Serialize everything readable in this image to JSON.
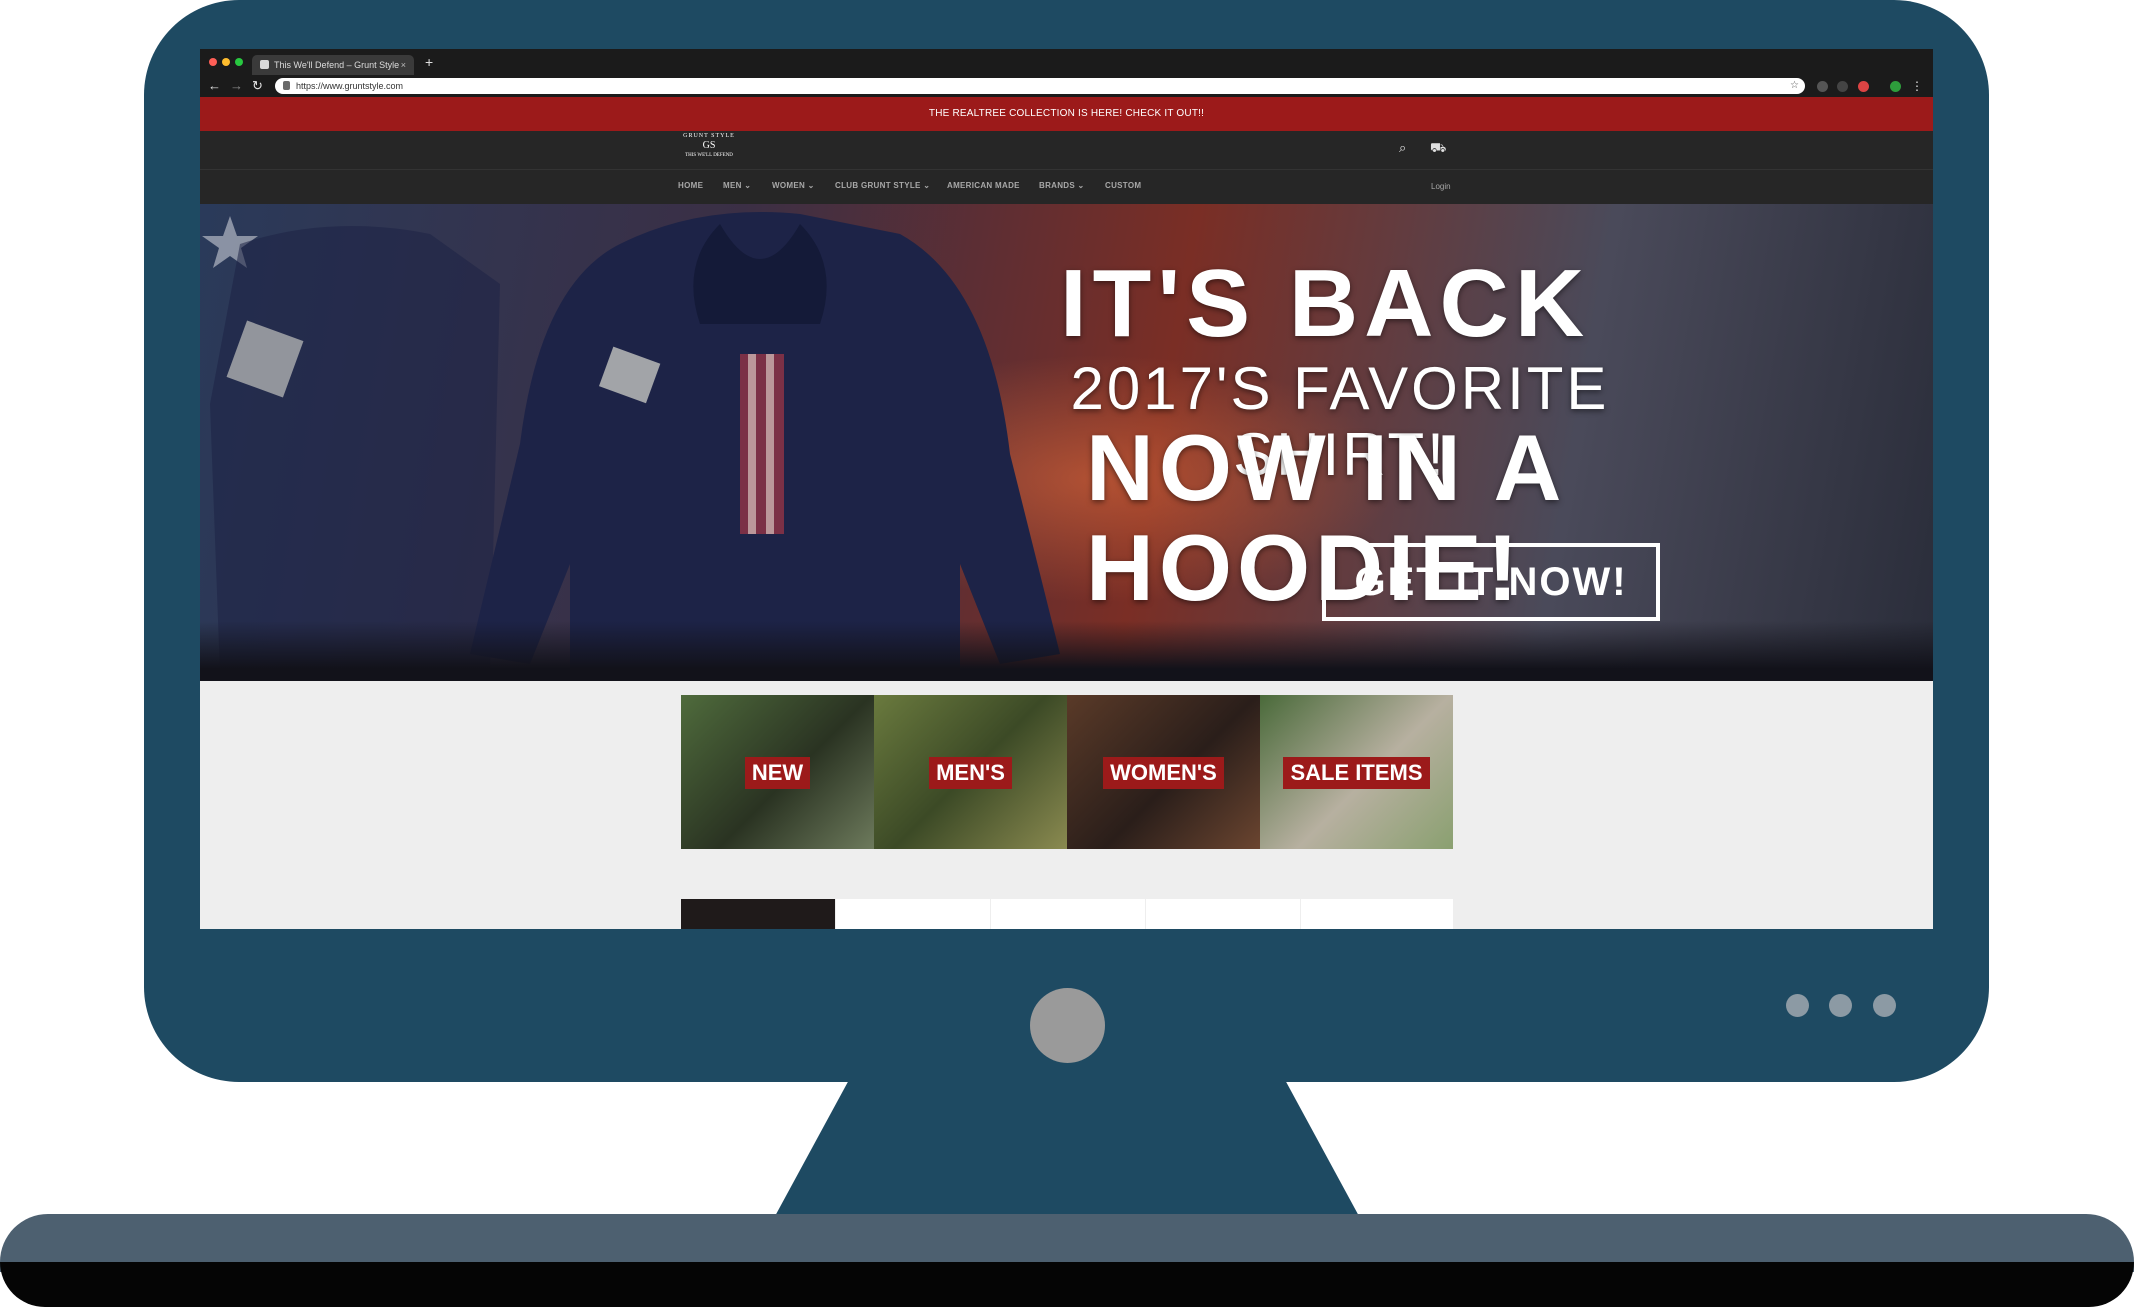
{
  "browser": {
    "tab_title": "This We'll Defend – Grunt Style",
    "tab_close": "×",
    "new_tab": "+",
    "url": "https://www.gruntstyle.com",
    "back_icon": "←",
    "forward_icon": "→",
    "reload_icon": "↻",
    "bookmark_icon": "☆",
    "menu_icon": "⋮"
  },
  "promo_bar": {
    "text": "THE REALTREE COLLECTION IS HERE! CHECK IT OUT!!"
  },
  "header": {
    "logo_top": "GRUNT STYLE",
    "logo_mid": "GS",
    "logo_bottom": "THIS WE'LL DEFEND",
    "search_icon": "⌕",
    "cart_icon": "⛟"
  },
  "nav": {
    "items": [
      {
        "label": "HOME"
      },
      {
        "label": "MEN ⌄"
      },
      {
        "label": "WOMEN ⌄"
      },
      {
        "label": "CLUB GRUNT STYLE ⌄"
      },
      {
        "label": "AMERICAN MADE"
      },
      {
        "label": "BRANDS ⌄"
      },
      {
        "label": "CUSTOM"
      }
    ],
    "login": "Login"
  },
  "hero": {
    "line1": "IT'S BACK",
    "line2": "2017'S FAVORITE SHIRT!",
    "line3": "NOW IN A HOODIE!",
    "cta": "GET IT NOW!"
  },
  "categories": [
    {
      "label": "NEW"
    },
    {
      "label": "MEN'S"
    },
    {
      "label": "WOMEN'S"
    },
    {
      "label": "SALE ITEMS"
    }
  ],
  "colors": {
    "bezel": "#1e4a62",
    "brand_red": "#9c1a1a",
    "header_dark": "#262626"
  }
}
